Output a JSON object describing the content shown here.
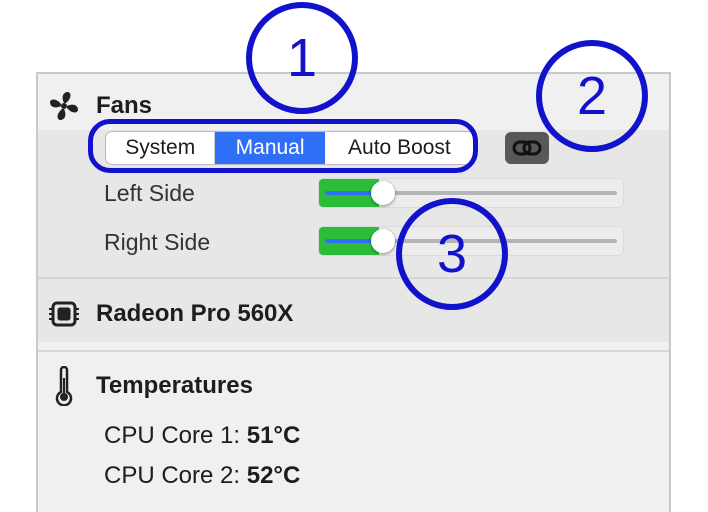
{
  "fans": {
    "title": "Fans",
    "mode_options": [
      "System",
      "Manual",
      "Auto Boost"
    ],
    "selected_mode": "Manual",
    "link_icon": "link-icon",
    "fan_rows": [
      {
        "label": "Left Side",
        "level": 0.2
      },
      {
        "label": "Right Side",
        "level": 0.2
      }
    ]
  },
  "gpu": {
    "title": "Radeon Pro 560X"
  },
  "temperatures": {
    "title": "Temperatures",
    "rows": [
      {
        "label": "CPU Core 1:",
        "value": "51°C"
      },
      {
        "label": "CPU Core 2:",
        "value": "52°C"
      }
    ]
  },
  "annotations": [
    "1",
    "2",
    "3"
  ],
  "colors": {
    "accent": "#2f6ef6",
    "fan_fill": "#2bbd3a",
    "annotation": "#1212cc"
  }
}
